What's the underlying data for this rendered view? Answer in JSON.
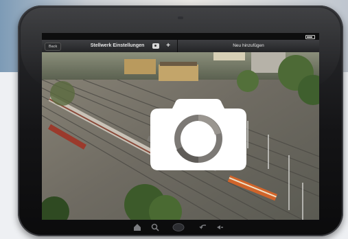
{
  "statusbar": {
    "carrier": "",
    "time": ""
  },
  "navbar": {
    "back_label": "Back",
    "title": "Stellwerk Einstellungen",
    "camera_icon": "camera-icon",
    "plus_label": "+",
    "right_title": "Neu hinzufügen"
  },
  "overlay": {
    "icon": "camera-icon",
    "background": "#ffffff",
    "lens_color": "#6f6c69"
  },
  "toolbar": {
    "icons": [
      "home-icon",
      "search-icon",
      "home-button",
      "back-icon",
      "menu-icon"
    ]
  },
  "colors": {
    "device": "#141416",
    "navbar": "#2f3033"
  }
}
